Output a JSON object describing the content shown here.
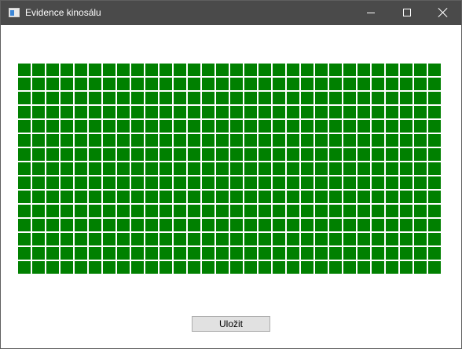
{
  "window": {
    "title": "Evidence kinosálu",
    "icon": "app-window-icon",
    "controls": {
      "minimize_icon": "minimize-icon",
      "maximize_icon": "maximize-icon",
      "close_icon": "close-icon"
    }
  },
  "seating": {
    "rows": 15,
    "columns": 30,
    "seat_status": "free",
    "free_color": "#008000"
  },
  "actions": {
    "save_label": "Uložit"
  },
  "colors": {
    "titlebar": "#4a4a4a",
    "title_text": "#ffffff",
    "window_background": "#ffffff",
    "button_background": "#e1e1e1",
    "button_border": "#adadad"
  }
}
